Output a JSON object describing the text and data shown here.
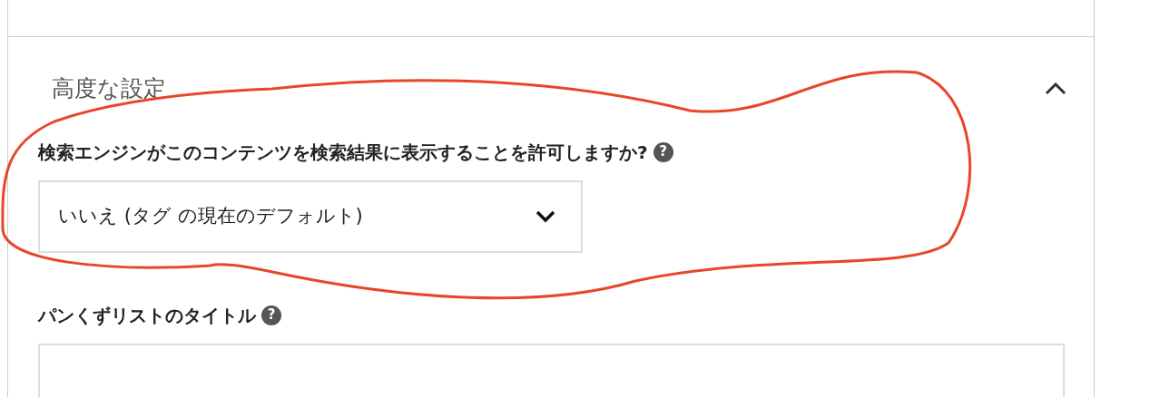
{
  "section": {
    "title": "高度な設定",
    "expanded": true
  },
  "fields": [
    {
      "kind": "select",
      "label": "検索エンジンがこのコンテンツを検索結果に表示することを許可しますか?",
      "help": "?",
      "value": "いいえ (タグ の現在のデフォルト)"
    },
    {
      "kind": "text",
      "label": "パンくずリストのタイトル",
      "help": "?"
    }
  ],
  "annotation": {
    "kind": "freehand-loop",
    "color": "#e8462a"
  }
}
